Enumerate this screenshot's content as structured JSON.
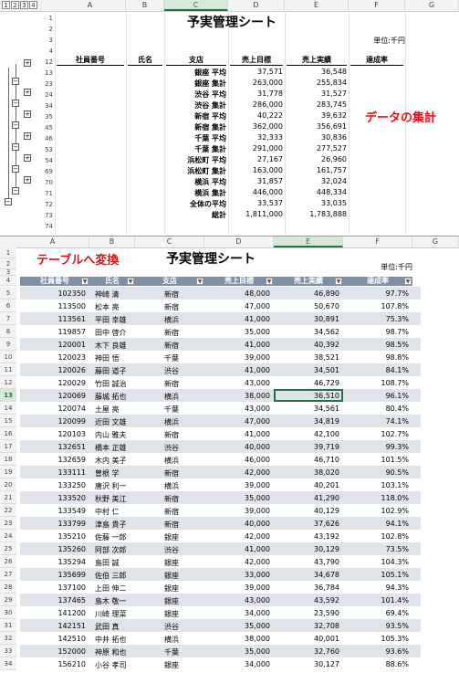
{
  "top": {
    "outline_levels": [
      "1",
      "2",
      "3",
      "4"
    ],
    "col_headers": [
      "A",
      "B",
      "C",
      "D",
      "E",
      "F",
      "G"
    ],
    "row_numbers": [
      "1",
      "2",
      "3",
      "4",
      "12",
      "13",
      "23",
      "24",
      "34",
      "35",
      "45",
      "46",
      "53",
      "54",
      "69",
      "70",
      "71",
      "72",
      "73",
      "74"
    ],
    "title": "予実管理シート",
    "unit": "単位:千円",
    "headers": [
      "社員番号",
      "氏名",
      "支店",
      "売上目標",
      "売上実績",
      "達成率"
    ],
    "rows": [
      [
        "銀座 平均",
        "37,571",
        "36,548"
      ],
      [
        "銀座 集計",
        "263,000",
        "255,834"
      ],
      [
        "渋谷 平均",
        "31,778",
        "31,527"
      ],
      [
        "渋谷 集計",
        "286,000",
        "283,745"
      ],
      [
        "新宿 平均",
        "40,222",
        "39,632"
      ],
      [
        "新宿 集計",
        "362,000",
        "356,691"
      ],
      [
        "千葉 平均",
        "32,333",
        "30,836"
      ],
      [
        "千葉 集計",
        "291,000",
        "277,527"
      ],
      [
        "浜松町 平均",
        "27,167",
        "26,960"
      ],
      [
        "浜松町 集計",
        "163,000",
        "161,757"
      ],
      [
        "横浜 平均",
        "31,857",
        "32,024"
      ],
      [
        "横浜 集計",
        "446,000",
        "448,334"
      ],
      [
        "全体の平均",
        "33,537",
        "33,035"
      ],
      [
        "総計",
        "1,811,000",
        "1,783,888"
      ]
    ],
    "annotation": "データの集計"
  },
  "bottom": {
    "col_headers": [
      "A",
      "B",
      "C",
      "D",
      "E",
      "F",
      "G"
    ],
    "annotation": "テーブルへ変換",
    "title": "予実管理シート",
    "unit": "単位:千円",
    "headers": [
      "社員番号",
      "氏名",
      "支店",
      "売上目標",
      "売上実績",
      "達成率"
    ],
    "selected_row": "13",
    "rows": [
      [
        "102350",
        "神崎 清",
        "新宿",
        "48,000",
        "46,890",
        "97.7%"
      ],
      [
        "113500",
        "松本 亮",
        "新宿",
        "47,000",
        "50,670",
        "107.8%"
      ],
      [
        "113561",
        "平田 幸雄",
        "横浜",
        "41,000",
        "30,891",
        "75.3%"
      ],
      [
        "119857",
        "田中 啓介",
        "新宿",
        "35,000",
        "34,562",
        "98.7%"
      ],
      [
        "120001",
        "木下 良雄",
        "新宿",
        "41,000",
        "40,392",
        "98.5%"
      ],
      [
        "120023",
        "神田 悟",
        "千葉",
        "39,000",
        "38,521",
        "98.8%"
      ],
      [
        "120026",
        "藤田 道子",
        "渋谷",
        "41,000",
        "34,501",
        "84.1%"
      ],
      [
        "120029",
        "竹田 誠治",
        "新宿",
        "43,000",
        "46,729",
        "108.7%"
      ],
      [
        "120069",
        "藤城 拓也",
        "横浜",
        "38,000",
        "36,510",
        "96.1%"
      ],
      [
        "120074",
        "土屋 亮",
        "千葉",
        "43,000",
        "34,561",
        "80.4%"
      ],
      [
        "120099",
        "近田 文雄",
        "横浜",
        "47,000",
        "34,819",
        "74.1%"
      ],
      [
        "120103",
        "内山 雅夫",
        "新宿",
        "41,000",
        "42,100",
        "102.7%"
      ],
      [
        "132651",
        "橋本 正雄",
        "渋谷",
        "40,000",
        "39,719",
        "99.3%"
      ],
      [
        "132659",
        "木内 美子",
        "横浜",
        "46,000",
        "46,710",
        "101.5%"
      ],
      [
        "133111",
        "曽根 学",
        "新宿",
        "42,000",
        "38,020",
        "90.5%"
      ],
      [
        "133250",
        "唐沢 利一",
        "横浜",
        "39,000",
        "40,201",
        "103.1%"
      ],
      [
        "133520",
        "秋野 美江",
        "新宿",
        "35,000",
        "41,290",
        "118.0%"
      ],
      [
        "133549",
        "中村 仁",
        "新宿",
        "39,000",
        "40,129",
        "102.9%"
      ],
      [
        "133799",
        "津島 貴子",
        "新宿",
        "40,000",
        "37,626",
        "94.1%"
      ],
      [
        "135210",
        "佐藤 一郎",
        "銀座",
        "42,000",
        "43,192",
        "102.8%"
      ],
      [
        "135260",
        "阿部 次郎",
        "渋谷",
        "41,000",
        "30,129",
        "73.5%"
      ],
      [
        "135294",
        "島田 誠",
        "銀座",
        "42,000",
        "43,790",
        "104.3%"
      ],
      [
        "135699",
        "佐伯 三郎",
        "銀座",
        "33,000",
        "34,678",
        "105.1%"
      ],
      [
        "137100",
        "上田 伸二",
        "銀座",
        "39,000",
        "36,784",
        "94.3%"
      ],
      [
        "137465",
        "島木 敬一",
        "銀座",
        "43,000",
        "43,592",
        "101.4%"
      ],
      [
        "141200",
        "川崎 理菜",
        "銀座",
        "34,000",
        "23,590",
        "69.4%"
      ],
      [
        "142151",
        "武田 真",
        "渋谷",
        "35,000",
        "32,708",
        "93.5%"
      ],
      [
        "142510",
        "中井 拓也",
        "横浜",
        "38,000",
        "40,001",
        "105.3%"
      ],
      [
        "152000",
        "神原 和也",
        "千葉",
        "35,000",
        "32,760",
        "93.6%"
      ],
      [
        "156210",
        "小谷 孝司",
        "銀座",
        "34,000",
        "30,127",
        "88.6%"
      ]
    ]
  }
}
